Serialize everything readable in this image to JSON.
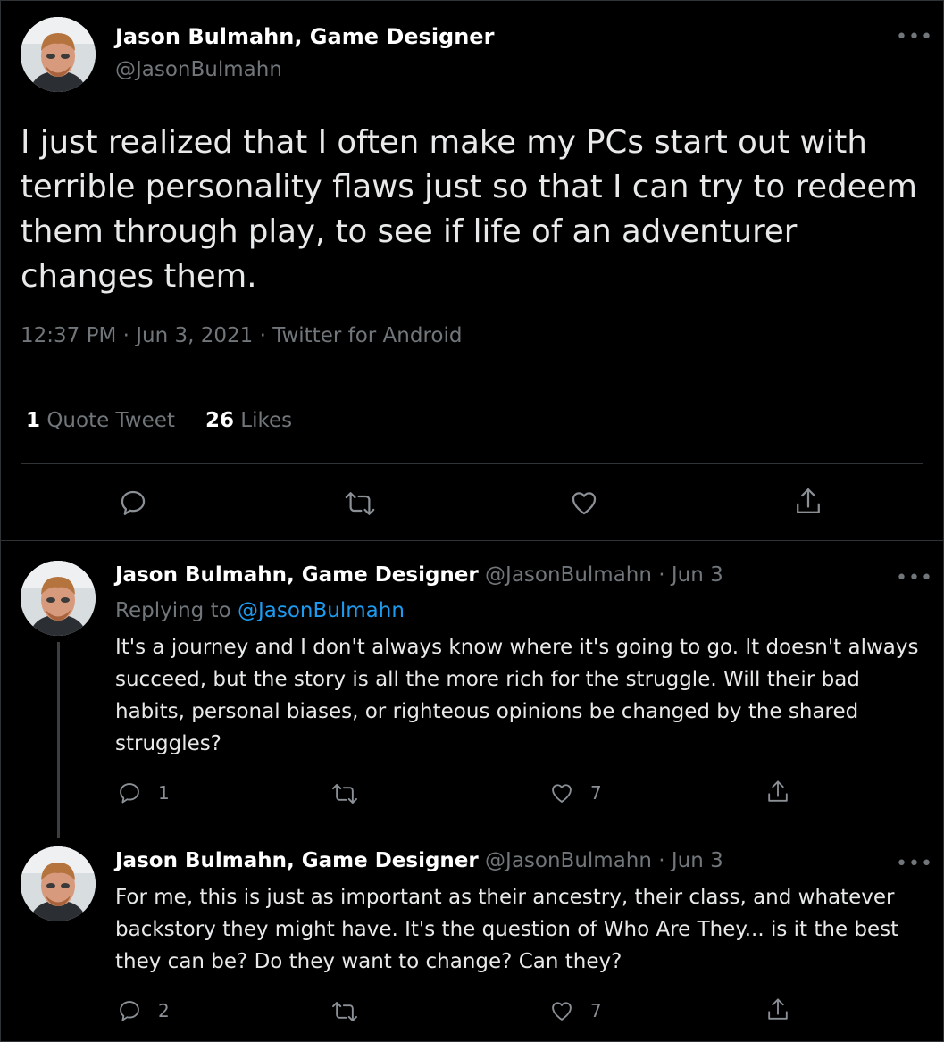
{
  "main_tweet": {
    "author_name": "Jason Bulmahn, Game Designer",
    "author_handle": "@JasonBulmahn",
    "more_icon": "more-icon",
    "text": "I just realized that I often make my PCs start out with terrible personality flaws just so that I can try to redeem them through play, to see if life of an adventurer changes them.",
    "meta": "12:37 PM · Jun 3, 2021 · Twitter for Android",
    "stats": {
      "quote_count": "1",
      "quote_label": "Quote Tweet",
      "like_count": "26",
      "like_label": "Likes"
    }
  },
  "replies": [
    {
      "author_name": "Jason Bulmahn, Game Designer",
      "author_handle": "@JasonBulmahn",
      "date": "· Jun 3",
      "replying_prefix": "Replying to",
      "replying_to": "@JasonBulmahn",
      "text": "It's a journey and I don't always know where it's going to go. It doesn't always succeed, but the story is all the more rich for the struggle. Will their bad habits, personal biases, or righteous opinions be changed by the shared struggles?",
      "reply_count": "1",
      "like_count": "7"
    },
    {
      "author_name": "Jason Bulmahn, Game Designer",
      "author_handle": "@JasonBulmahn",
      "date": "· Jun 3",
      "text": "For me, this is just as important as their ancestry, their class, and whatever backstory they might have. It's the question of Who Are They... is it the best they can be? Do they want to change? Can they?",
      "reply_count": "2",
      "like_count": "7"
    }
  ],
  "icons": [
    "reply-icon",
    "retweet-icon",
    "like-icon",
    "share-icon",
    "more-icon"
  ],
  "colors": {
    "background": "#000000",
    "link": "#1d9bf0",
    "muted": "#71767b",
    "text": "#e7e9ea"
  }
}
